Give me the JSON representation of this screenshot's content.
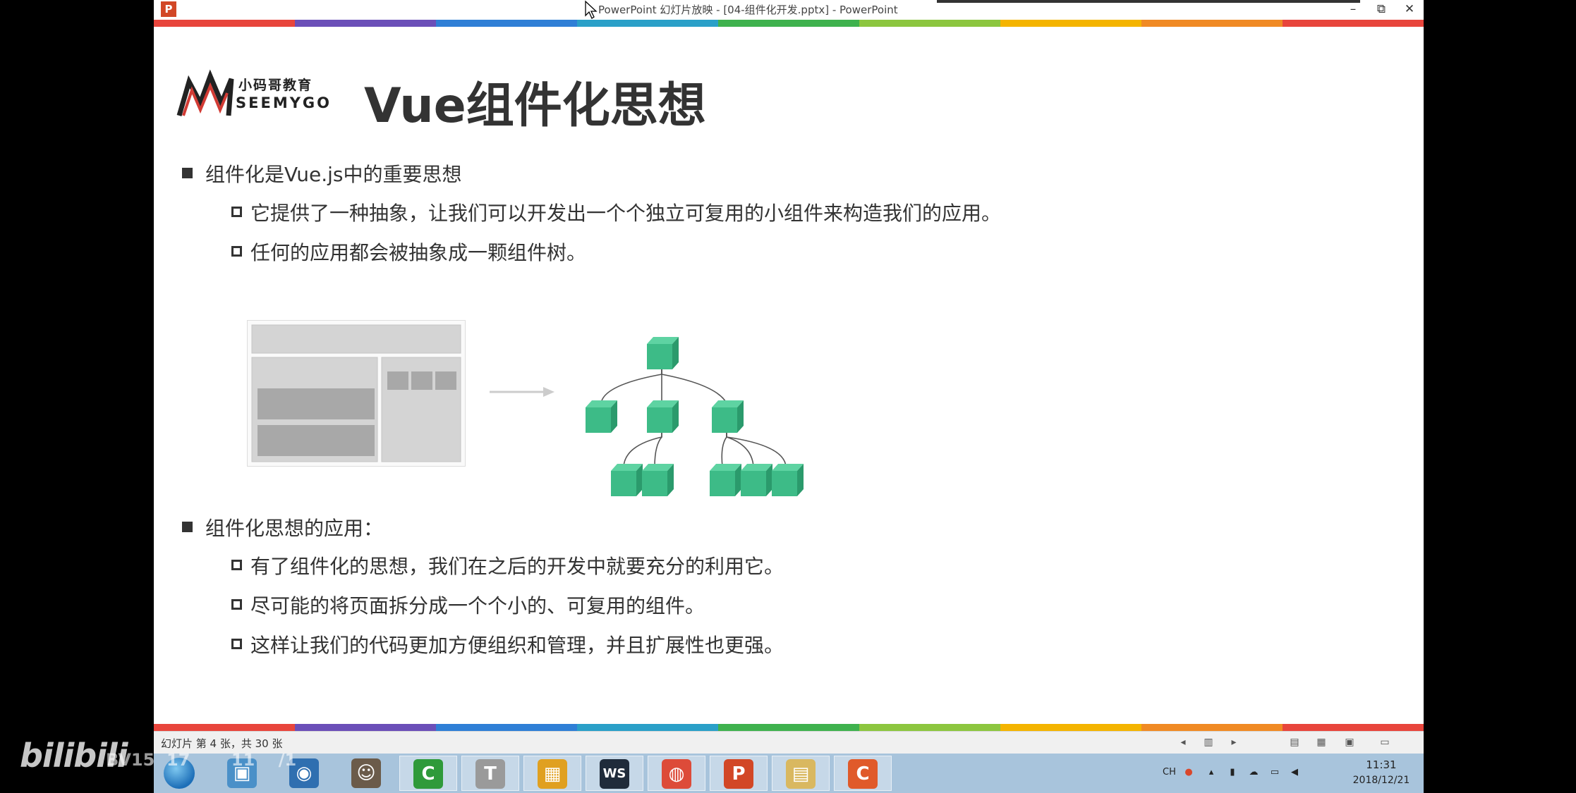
{
  "window": {
    "app_icon": "P",
    "title": "PowerPoint 幻灯片放映 - [04-组件化开发.pptx] - PowerPoint",
    "minimize_icon": "minimize-icon",
    "restore_icon": "restore-icon",
    "close_icon": "close-icon"
  },
  "rainbow_colors": [
    "#e8453c",
    "#6b4fb8",
    "#2f7fd6",
    "#2aa0c8",
    "#3fb24e",
    "#8cc63f",
    "#f4b400",
    "#f08a24",
    "#e8453c"
  ],
  "slide": {
    "logo": {
      "cn": "小码哥教育",
      "en": "SEEMYGO"
    },
    "title": "Vue组件化思想",
    "section1": {
      "heading": "组件化是Vue.js中的重要思想",
      "points": [
        "它提供了一种抽象，让我们可以开发出一个个独立可复用的小组件来构造我们的应用。",
        "任何的应用都会被抽象成一颗组件树。"
      ]
    },
    "diagram": {
      "arrow": "arrow-right-icon",
      "node_color": "#3dbb87"
    },
    "section2": {
      "heading": "组件化思想的应用：",
      "points": [
        "有了组件化的思想，我们在之后的开发中就要充分的利用它。",
        "尽可能的将页面拆分成一个个小的、可复用的组件。",
        "这样让我们的代码更加方便组织和管理，并且扩展性也更强。"
      ]
    }
  },
  "statusbar": {
    "slide_info": "幻灯片 第 4 张，共 30 张"
  },
  "taskbar": {
    "apps": [
      {
        "name": "explorer-app",
        "glyph": "▣",
        "color": "#4a90c8"
      },
      {
        "name": "media-app",
        "glyph": "◉",
        "color": "#2f6fb0"
      },
      {
        "name": "user-app",
        "glyph": "☺",
        "color": "#6b5b4a"
      },
      {
        "name": "camtasia-app",
        "glyph": "C",
        "color": "#2f9a3a"
      },
      {
        "name": "typora-app",
        "glyph": "T",
        "color": "#9a9a9a"
      },
      {
        "name": "webstorm-colors-app",
        "glyph": "▦",
        "color": "#e0a020"
      },
      {
        "name": "webstorm-app",
        "glyph": "WS",
        "color": "#1f2b3a"
      },
      {
        "name": "chrome-app",
        "glyph": "◍",
        "color": "#dd4b39"
      },
      {
        "name": "powerpoint-app",
        "glyph": "P",
        "color": "#d24726"
      },
      {
        "name": "files-app",
        "glyph": "▤",
        "color": "#d9b860"
      },
      {
        "name": "recorder-app",
        "glyph": "C",
        "color": "#e05a2a"
      }
    ],
    "time": "11:31",
    "date": "2018/12/21",
    "ime": "CH"
  },
  "watermark": {
    "logo": "bilibili",
    "id": "BV15  17       11    /1   "
  }
}
